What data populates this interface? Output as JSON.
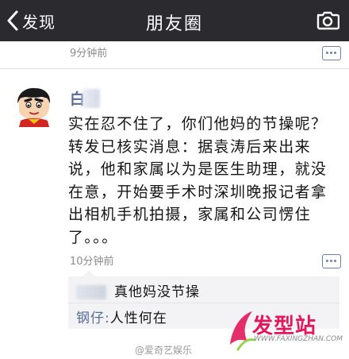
{
  "nav": {
    "back_label": "发现",
    "title": "朋友圈"
  },
  "previous_post": {
    "time": "9分钟前"
  },
  "post": {
    "author": "白",
    "text": "实在忍不住了，你们他妈的节操呢？转发已核实消息：据袁涛后来出来说，他和家属以为是医生助理，就没在意，开始要手术时深圳晚报记者拿出相机手机拍摄，家属和公司愣住了。。。",
    "time": "10分钟前"
  },
  "comments": [
    {
      "name": "",
      "text": "真他妈没节操"
    },
    {
      "name": "钢仔:",
      "text": "人性何在"
    }
  ],
  "watermarks": {
    "weibo": "@爱奇艺娱乐",
    "site_cn": "发型站",
    "site_url": "WWW.FAXINGZHAN.COM"
  },
  "colors": {
    "nav_bg": "#2b2a2f",
    "link_blue": "#576b95",
    "watermark_pink": "#e2185a"
  }
}
